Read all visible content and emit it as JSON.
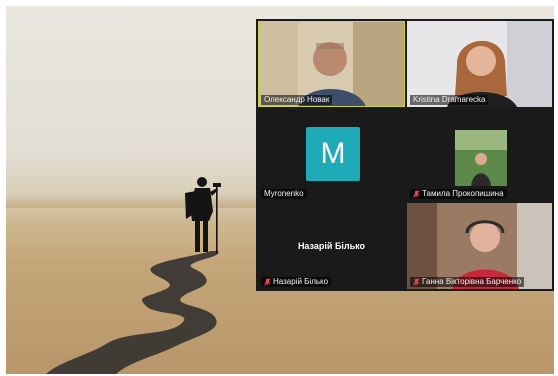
{
  "participants": [
    {
      "name": "Олександр Новак",
      "muted": false,
      "active_speaker": true,
      "video": true
    },
    {
      "name": "Kristina Dramarecka",
      "muted": false,
      "active_speaker": false,
      "video": true
    },
    {
      "name": "Myronenko",
      "muted": false,
      "active_speaker": false,
      "video": false,
      "avatar_letter": "M"
    },
    {
      "name": "Тамила Прокопишина",
      "muted": true,
      "active_speaker": false,
      "video": true
    },
    {
      "name": "Назарій Білько",
      "muted": true,
      "active_speaker": false,
      "video": false,
      "center_name": "Назарій Білько"
    },
    {
      "name": "Ганна Вікторівна Барченко",
      "muted": true,
      "active_speaker": false,
      "video": true
    }
  ],
  "colors": {
    "avatar_bg": "#1faab8",
    "active_border": "#c9d33a",
    "muted_icon": "#e5484d",
    "panel_bg": "#1a1a1a"
  }
}
